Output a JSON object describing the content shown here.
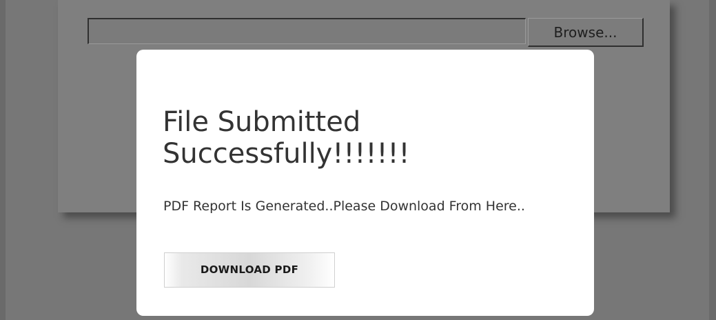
{
  "upload_form": {
    "file_input_value": "",
    "browse_label": "Browse..."
  },
  "modal": {
    "title": "File Submitted Successfully!!!!!!!",
    "message": "PDF Report Is Generated..Please Download From Here..",
    "download_label": "DOWNLOAD PDF"
  },
  "colors": {
    "overlay": "#777777",
    "modal_background": "#ffffff",
    "text": "#333333"
  }
}
